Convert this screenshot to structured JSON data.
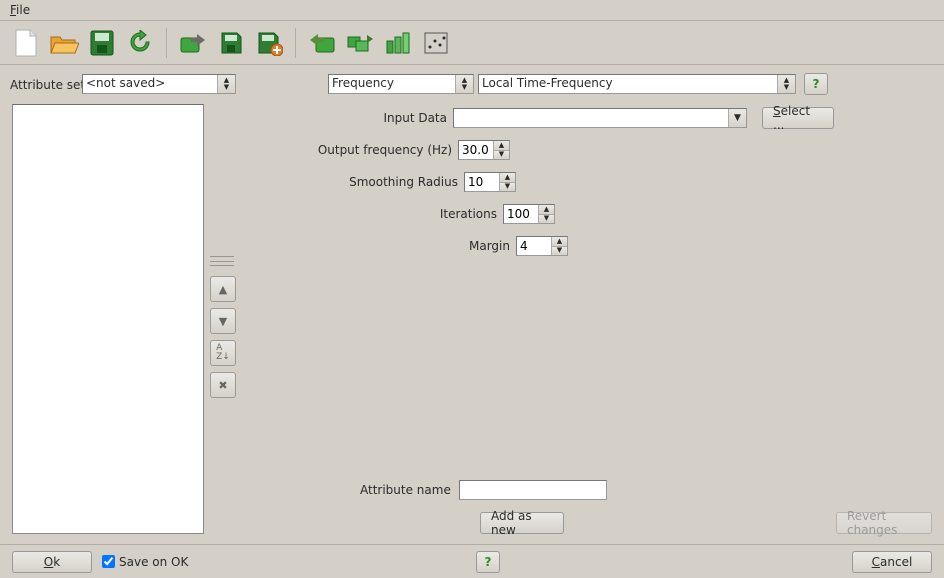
{
  "menubar": {
    "file": "File"
  },
  "toolbar_icons": [
    "new-icon",
    "open-icon",
    "save-all-icon",
    "cycle-icon",
    "export-icon",
    "save-icon",
    "save-as-icon",
    "import-icon",
    "multi-export-icon",
    "scripts-icon",
    "histogram-icon"
  ],
  "labels": {
    "attribute_set": "Attribute set",
    "input_data": "Input Data",
    "output_frequency": "Output frequency (Hz)",
    "smoothing_radius": "Smoothing Radius",
    "iterations": "Iterations",
    "margin": "Margin",
    "attribute_name": "Attribute name",
    "add_as_new": "Add as new",
    "revert": "Revert changes",
    "select": "Select ...",
    "ok": "Ok",
    "cancel": "Cancel",
    "save_on_ok": "Save on OK"
  },
  "attribute_set_combo": "<not saved>",
  "category_combo": "Frequency",
  "algorithm_combo": "Local Time-Frequency",
  "input_data_combo": "",
  "output_frequency": "30.0",
  "smoothing_radius": "10",
  "iterations": "100",
  "margin": "4",
  "attribute_name": "",
  "save_on_ok_checked": true
}
